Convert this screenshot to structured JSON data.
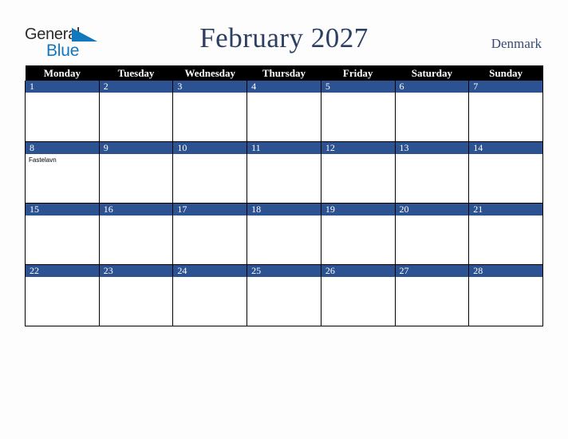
{
  "brand": {
    "name_part1": "General",
    "name_part2": "Blue",
    "triangle_color": "#1278be",
    "part1_color": "#2b2b2b",
    "part2_color": "#1278be"
  },
  "header": {
    "title": "February 2027",
    "country": "Denmark",
    "title_color": "#2c3e63",
    "country_color": "#3a4a71"
  },
  "calendar": {
    "weekday_headers": [
      "Monday",
      "Tuesday",
      "Wednesday",
      "Thursday",
      "Friday",
      "Saturday",
      "Sunday"
    ],
    "header_bg": "#000000",
    "header_fg": "#ffffff",
    "daynum_bg": "#2d5292",
    "daynum_fg": "#ffffff",
    "cell_bg": "#ffffff",
    "grid_color": "#000000",
    "weeks": [
      [
        {
          "day": "1",
          "events": []
        },
        {
          "day": "2",
          "events": []
        },
        {
          "day": "3",
          "events": []
        },
        {
          "day": "4",
          "events": []
        },
        {
          "day": "5",
          "events": []
        },
        {
          "day": "6",
          "events": []
        },
        {
          "day": "7",
          "events": []
        }
      ],
      [
        {
          "day": "8",
          "events": [
            "Fastelavn"
          ]
        },
        {
          "day": "9",
          "events": []
        },
        {
          "day": "10",
          "events": []
        },
        {
          "day": "11",
          "events": []
        },
        {
          "day": "12",
          "events": []
        },
        {
          "day": "13",
          "events": []
        },
        {
          "day": "14",
          "events": []
        }
      ],
      [
        {
          "day": "15",
          "events": []
        },
        {
          "day": "16",
          "events": []
        },
        {
          "day": "17",
          "events": []
        },
        {
          "day": "18",
          "events": []
        },
        {
          "day": "19",
          "events": []
        },
        {
          "day": "20",
          "events": []
        },
        {
          "day": "21",
          "events": []
        }
      ],
      [
        {
          "day": "22",
          "events": []
        },
        {
          "day": "23",
          "events": []
        },
        {
          "day": "24",
          "events": []
        },
        {
          "day": "25",
          "events": []
        },
        {
          "day": "26",
          "events": []
        },
        {
          "day": "27",
          "events": []
        },
        {
          "day": "28",
          "events": []
        }
      ]
    ]
  }
}
